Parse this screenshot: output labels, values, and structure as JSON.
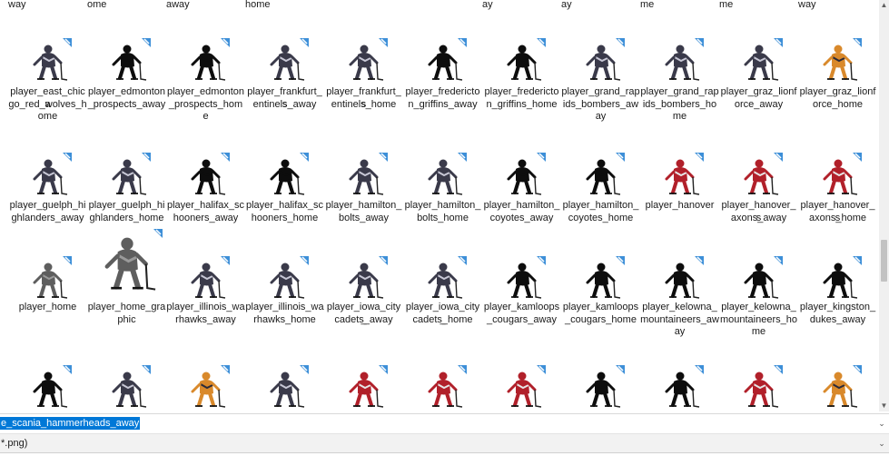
{
  "window": {
    "filename_value": "e_scania_hammerheads_away",
    "filetype_value": "*.png)"
  },
  "icons": {
    "file_badge": "arrow-badge-icon",
    "thumbnail": "hockey-player-thumbnail"
  },
  "partial_row": [
    "way",
    "ome",
    "away",
    "home",
    "",
    "",
    "ay",
    "ay",
    "me",
    "me",
    "way"
  ],
  "rows": [
    [
      {
        "name": "player_east_chicago_red_wolves_home",
        "lines": [
          "player_east_chica",
          "go_red_wolves_h",
          "ome"
        ],
        "style": "color"
      },
      {
        "name": "player_edmonton_prospects_away",
        "lines": [
          "player_edmonton",
          "_prospects_away"
        ],
        "style": "silhouette"
      },
      {
        "name": "player_edmonton_prospects_home",
        "lines": [
          "player_edmonton",
          "_prospects_home"
        ],
        "style": "silhouette"
      },
      {
        "name": "player_frankfurt_sentinels_away",
        "lines": [
          "player_frankfurt_s",
          "entinels_away"
        ],
        "style": "color"
      },
      {
        "name": "player_frankfurt_sentinels_home",
        "lines": [
          "player_frankfurt_s",
          "entinels_home"
        ],
        "style": "color"
      },
      {
        "name": "player_fredericton_griffins_away",
        "lines": [
          "player_fredericto",
          "n_griffins_away"
        ],
        "style": "silhouette"
      },
      {
        "name": "player_fredericton_griffins_home",
        "lines": [
          "player_fredericto",
          "n_griffins_home"
        ],
        "style": "silhouette"
      },
      {
        "name": "player_grand_rapids_bombers_away",
        "lines": [
          "player_grand_rap",
          "ids_bombers_aw",
          "ay"
        ],
        "style": "color"
      },
      {
        "name": "player_grand_rapids_bombers_home",
        "lines": [
          "player_grand_rap",
          "ids_bombers_ho",
          "me"
        ],
        "style": "color"
      },
      {
        "name": "player_graz_lionforce_away",
        "lines": [
          "player_graz_lionf",
          "orce_away"
        ],
        "style": "color"
      },
      {
        "name": "player_graz_lionforce_home",
        "lines": [
          "player_graz_lionf",
          "orce_home"
        ],
        "style": "orange"
      }
    ],
    [
      {
        "name": "player_guelph_highlanders_away",
        "lines": [
          "player_guelph_hi",
          "ghlanders_away"
        ],
        "style": "color"
      },
      {
        "name": "player_guelph_highlanders_home",
        "lines": [
          "player_guelph_hi",
          "ghlanders_home"
        ],
        "style": "color"
      },
      {
        "name": "player_halifax_schooners_away",
        "lines": [
          "player_halifax_sc",
          "hooners_away"
        ],
        "style": "silhouette"
      },
      {
        "name": "player_halifax_schooners_home",
        "lines": [
          "player_halifax_sc",
          "hooners_home"
        ],
        "style": "silhouette"
      },
      {
        "name": "player_hamilton_bolts_away",
        "lines": [
          "player_hamilton_",
          "bolts_away"
        ],
        "style": "color"
      },
      {
        "name": "player_hamilton_bolts_home",
        "lines": [
          "player_hamilton_",
          "bolts_home"
        ],
        "style": "color"
      },
      {
        "name": "player_hamilton_coyotes_away",
        "lines": [
          "player_hamilton_",
          "coyotes_away"
        ],
        "style": "silhouette"
      },
      {
        "name": "player_hamilton_coyotes_home",
        "lines": [
          "player_hamilton_",
          "coyotes_home"
        ],
        "style": "silhouette"
      },
      {
        "name": "player_hanover",
        "lines": [
          "player_hanover"
        ],
        "style": "red"
      },
      {
        "name": "player_hanover_saxons_away",
        "lines": [
          "player_hanover_s",
          "axons_away"
        ],
        "style": "red"
      },
      {
        "name": "player_hanover_saxons_home",
        "lines": [
          "player_hanover_s",
          "axons_home"
        ],
        "style": "red"
      }
    ],
    [
      {
        "name": "player_home",
        "lines": [
          "player_home"
        ],
        "style": "gray"
      },
      {
        "name": "player_home_graphic",
        "lines": [
          "player_home_gra",
          "phic"
        ],
        "style": "gray"
      },
      {
        "name": "player_illinois_warhawks_away",
        "lines": [
          "player_illinois_wa",
          "rhawks_away"
        ],
        "style": "color"
      },
      {
        "name": "player_illinois_warhawks_home",
        "lines": [
          "player_illinois_wa",
          "rhawks_home"
        ],
        "style": "color"
      },
      {
        "name": "player_iowa_city_cadets_away",
        "lines": [
          "player_iowa_city_",
          "cadets_away"
        ],
        "style": "color"
      },
      {
        "name": "player_iowa_city_cadets_home",
        "lines": [
          "player_iowa_city_",
          "cadets_home"
        ],
        "style": "color"
      },
      {
        "name": "player_kamloops_cougars_away",
        "lines": [
          "player_kamloops",
          "_cougars_away"
        ],
        "style": "silhouette"
      },
      {
        "name": "player_kamloops_cougars_home",
        "lines": [
          "player_kamloops",
          "_cougars_home"
        ],
        "style": "silhouette"
      },
      {
        "name": "player_kelowna_mountaineers_away",
        "lines": [
          "player_kelowna_",
          "mountaineers_aw",
          "ay"
        ],
        "style": "silhouette"
      },
      {
        "name": "player_kelowna_mountaineers_home",
        "lines": [
          "player_kelowna_",
          "mountaineers_ho",
          "me"
        ],
        "style": "silhouette"
      },
      {
        "name": "player_kingston_dukes_away",
        "lines": [
          "player_kingston_",
          "dukes_away"
        ],
        "style": "silhouette"
      }
    ],
    [
      {
        "name": "",
        "lines": [],
        "style": "silhouette"
      },
      {
        "name": "",
        "lines": [],
        "style": "color"
      },
      {
        "name": "",
        "lines": [],
        "style": "orange"
      },
      {
        "name": "",
        "lines": [],
        "style": "color"
      },
      {
        "name": "",
        "lines": [],
        "style": "red"
      },
      {
        "name": "",
        "lines": [],
        "style": "red"
      },
      {
        "name": "",
        "lines": [],
        "style": "red"
      },
      {
        "name": "",
        "lines": [],
        "style": "silhouette"
      },
      {
        "name": "",
        "lines": [],
        "style": "silhouette"
      },
      {
        "name": "",
        "lines": [],
        "style": "red"
      },
      {
        "name": "",
        "lines": [],
        "style": "orange"
      }
    ]
  ],
  "style_colors": {
    "silhouette": {
      "body": "#0d0d0d",
      "accent": "#0d0d0d"
    },
    "color": {
      "body": "#3a3a4a",
      "accent": "#c8c8d6"
    },
    "red": {
      "body": "#b1202a",
      "accent": "#e6e6e6"
    },
    "orange": {
      "body": "#d9892b",
      "accent": "#2a2a3a"
    },
    "gray": {
      "body": "#5e5e5e",
      "accent": "#9a9a9a"
    }
  },
  "accent_badge_color": "#3d8fd8"
}
